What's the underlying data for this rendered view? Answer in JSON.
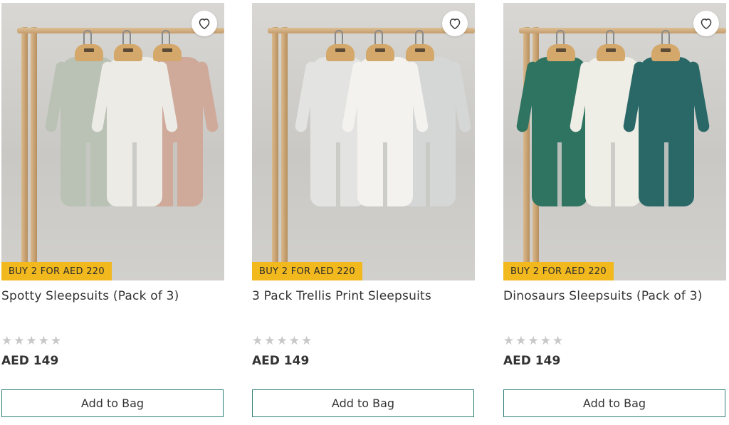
{
  "products": [
    {
      "offer_label": "BUY 2 FOR AED 220",
      "title": "Spotty Sleepsuits (Pack of 3)",
      "rating_stars": 0,
      "price": "AED 149",
      "cta_label": "Add to Bag",
      "suit_colors": [
        "#b9c2b4",
        "#ecebe6",
        "#cfa99a"
      ]
    },
    {
      "offer_label": "BUY 2 FOR AED 220",
      "title": "3 Pack Trellis Print Sleepsuits",
      "rating_stars": 0,
      "price": "AED 149",
      "cta_label": "Add to Bag",
      "suit_colors": [
        "#e3e3e1",
        "#f3f2ee",
        "#d5d6d6"
      ]
    },
    {
      "offer_label": "BUY 2 FOR AED 220",
      "title": "Dinosaurs Sleepsuits (Pack of 3)",
      "rating_stars": 0,
      "price": "AED 149",
      "cta_label": "Add to Bag",
      "suit_colors": [
        "#2f7461",
        "#efeee6",
        "#2a6868"
      ]
    }
  ],
  "colors": {
    "offer_badge": "#f2b91f",
    "button_border": "#2c7d78",
    "star_empty": "#c8c8c8"
  },
  "icons": {
    "wishlist": "heart-outline-icon",
    "rating": "star-icon"
  }
}
